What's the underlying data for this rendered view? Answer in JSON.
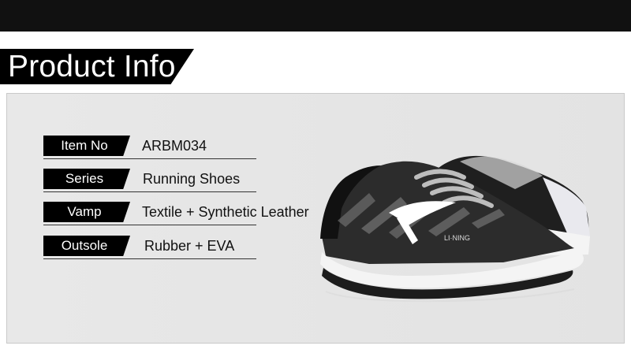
{
  "header": {
    "title": "Product Info"
  },
  "specs": [
    {
      "label": "Item No",
      "value": "ARBM034"
    },
    {
      "label": "Series",
      "value": "Running Shoes"
    },
    {
      "label": "Vamp",
      "value": "Textile + Synthetic Leather"
    },
    {
      "label": "Outsole",
      "value": "Rubber + EVA"
    }
  ],
  "product_image": {
    "icon": "running-shoe-image",
    "colors": {
      "upper": "#2b2b2b",
      "sole": "#f2f2f2",
      "accent": "#ffffff"
    }
  }
}
